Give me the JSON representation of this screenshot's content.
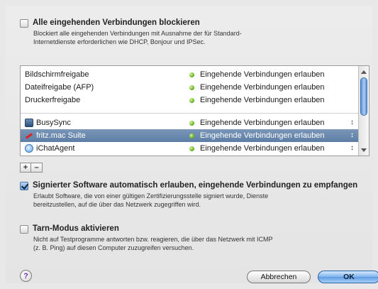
{
  "block_all": {
    "label": "Alle eingehenden Verbindungen blockieren",
    "checked": false,
    "description_line1": "Blockiert alle eingehenden Verbindungen mit Ausnahme der für Standard-",
    "description_line2": "Internetdienste erforderlichen wie DHCP, Bonjour und IPSec."
  },
  "services": [
    {
      "name": "Bildschirmfreigabe",
      "status": "Eingehende Verbindungen erlauben",
      "status_color": "#6bb624"
    },
    {
      "name": "Dateifreigabe (AFP)",
      "status": "Eingehende Verbindungen erlauben",
      "status_color": "#6bb624"
    },
    {
      "name": "Druckerfreigabe",
      "status": "Eingehende Verbindungen erlauben",
      "status_color": "#6bb624"
    }
  ],
  "apps": [
    {
      "name": "BusySync",
      "icon": "busysync-icon",
      "status": "Eingehende Verbindungen erlauben",
      "selected": false
    },
    {
      "name": "fritz.mac Suite",
      "icon": "fritz-icon",
      "status": "Eingehende Verbindungen erlauben",
      "selected": true
    },
    {
      "name": "iChatAgent",
      "icon": "ichat-icon",
      "status": "Eingehende Verbindungen erlauben",
      "selected": false
    }
  ],
  "spinner_glyph": "↕",
  "buttons": {
    "add": "+",
    "remove": "–",
    "cancel": "Abbrechen",
    "ok": "OK",
    "help": "?"
  },
  "signed_software": {
    "label": "Signierter Software automatisch erlauben, eingehende Verbindungen zu empfangen",
    "checked": true,
    "description_line1": "Erlaubt Software, die von einer gültigen Zertifizierungsstelle signiert wurde, Dienste",
    "description_line2": "bereitzustellen, auf die über das Netzwerk zugegriffen wird."
  },
  "stealth_mode": {
    "label": "Tarn-Modus aktivieren",
    "checked": false,
    "description_line1": "Nicht auf Testprogramme antworten bzw. reagieren, die über das Netzwerk mit ICMP",
    "description_line2": "(z. B. Ping) auf diesen Computer zuzugreifen versuchen."
  },
  "colors": {
    "accent": "#5e7ea6",
    "allow_dot": "#6bb624",
    "default_button": "#5d9ae3"
  }
}
